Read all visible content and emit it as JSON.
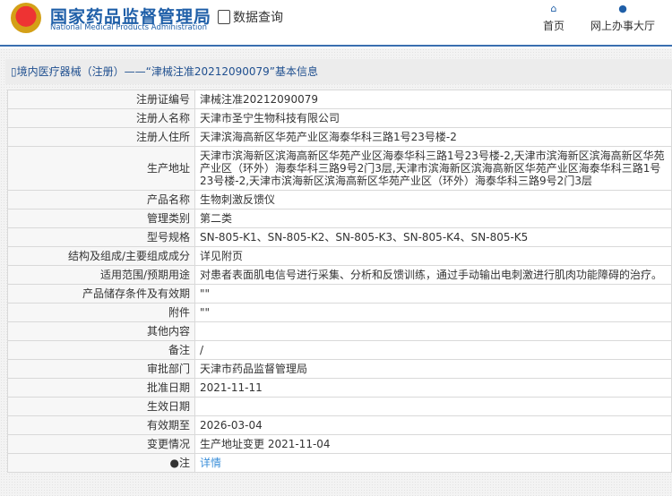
{
  "header": {
    "title": "国家药品监督管理局",
    "subtitle": "National Medical Products Administration",
    "query": "数据查询",
    "nav": [
      {
        "label": "首页",
        "icon": "home-icon"
      },
      {
        "label": "网上办事大厅",
        "icon": "user-icon"
      }
    ]
  },
  "page_title": "境内医疗器械（注册）——“津械注准20212090079”基本信息",
  "rows": [
    {
      "label": "注册证编号",
      "value": "津械注准20212090079"
    },
    {
      "label": "注册人名称",
      "value": "天津市圣宁生物科技有限公司"
    },
    {
      "label": "注册人住所",
      "value": "天津滨海高新区华苑产业区海泰华科三路1号23号楼-2"
    },
    {
      "label": "生产地址",
      "value": "天津市滨海新区滨海高新区华苑产业区海泰华科三路1号23号楼-2,天津市滨海新区滨海高新区华苑产业区（环外）海泰华科三路9号2门3层,天津市滨海新区滨海高新区华苑产业区海泰华科三路1号23号楼-2,天津市滨海新区滨海高新区华苑产业区（环外）海泰华科三路9号2门3层"
    },
    {
      "label": "产品名称",
      "value": "生物刺激反馈仪"
    },
    {
      "label": "管理类别",
      "value": "第二类"
    },
    {
      "label": "型号规格",
      "value": "SN-805-K1、SN-805-K2、SN-805-K3、SN-805-K4、SN-805-K5"
    },
    {
      "label": "结构及组成/主要组成成分",
      "value": "详见附页"
    },
    {
      "label": "适用范围/预期用途",
      "value": "对患者表面肌电信号进行采集、分析和反馈训练，通过手动输出电刺激进行肌肉功能障碍的治疗。"
    },
    {
      "label": "产品储存条件及有效期",
      "value": "\"\""
    },
    {
      "label": "附件",
      "value": "\"\""
    },
    {
      "label": "其他内容",
      "value": ""
    },
    {
      "label": "备注",
      "value": "/"
    },
    {
      "label": "审批部门",
      "value": "天津市药品监督管理局"
    },
    {
      "label": "批准日期",
      "value": "2021-11-11"
    },
    {
      "label": "生效日期",
      "value": ""
    },
    {
      "label": "有效期至",
      "value": "2026-03-04"
    },
    {
      "label": "变更情况",
      "value": "生产地址变更 2021-11-04"
    }
  ],
  "note": {
    "label": "注",
    "link": "详情"
  }
}
